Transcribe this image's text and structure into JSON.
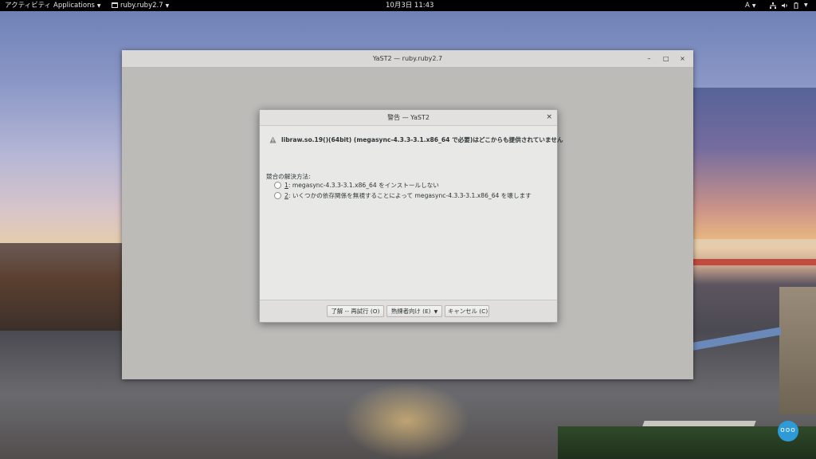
{
  "topbar": {
    "activities": "アクティビティ",
    "applications": "Applications",
    "app_menu": "ruby.ruby2.7",
    "clock": "10月3日  11:43",
    "input_method": "A"
  },
  "main_window": {
    "title": "YaST2 — ruby.ruby2.7"
  },
  "dialog": {
    "title": "警告 — YaST2",
    "close": "×",
    "warning": "libraw.so.19()(64bit) (megasync-4.3.3-3.1.x86_64 で必要)はどこからも提供されていません",
    "resolution_label": "競合の解決方法:",
    "options": [
      {
        "number": "1",
        "text": ": megasync-4.3.3-3.1.x86_64 をインストールしない"
      },
      {
        "number": "2",
        "text": ": いくつかの依存関係を無視することによって megasync-4.3.3-3.1.x86_64 を壊します"
      }
    ],
    "buttons": {
      "ok_retry": "了解 -- 再試行 (O)",
      "expert": "熟練者向け (E)",
      "cancel": "キャンセル (C)"
    }
  },
  "fab_label": "ooo",
  "colors": {
    "topbar": "#000000",
    "dialog_bg": "#e8e8e7",
    "fab": "#2e9ad7"
  }
}
